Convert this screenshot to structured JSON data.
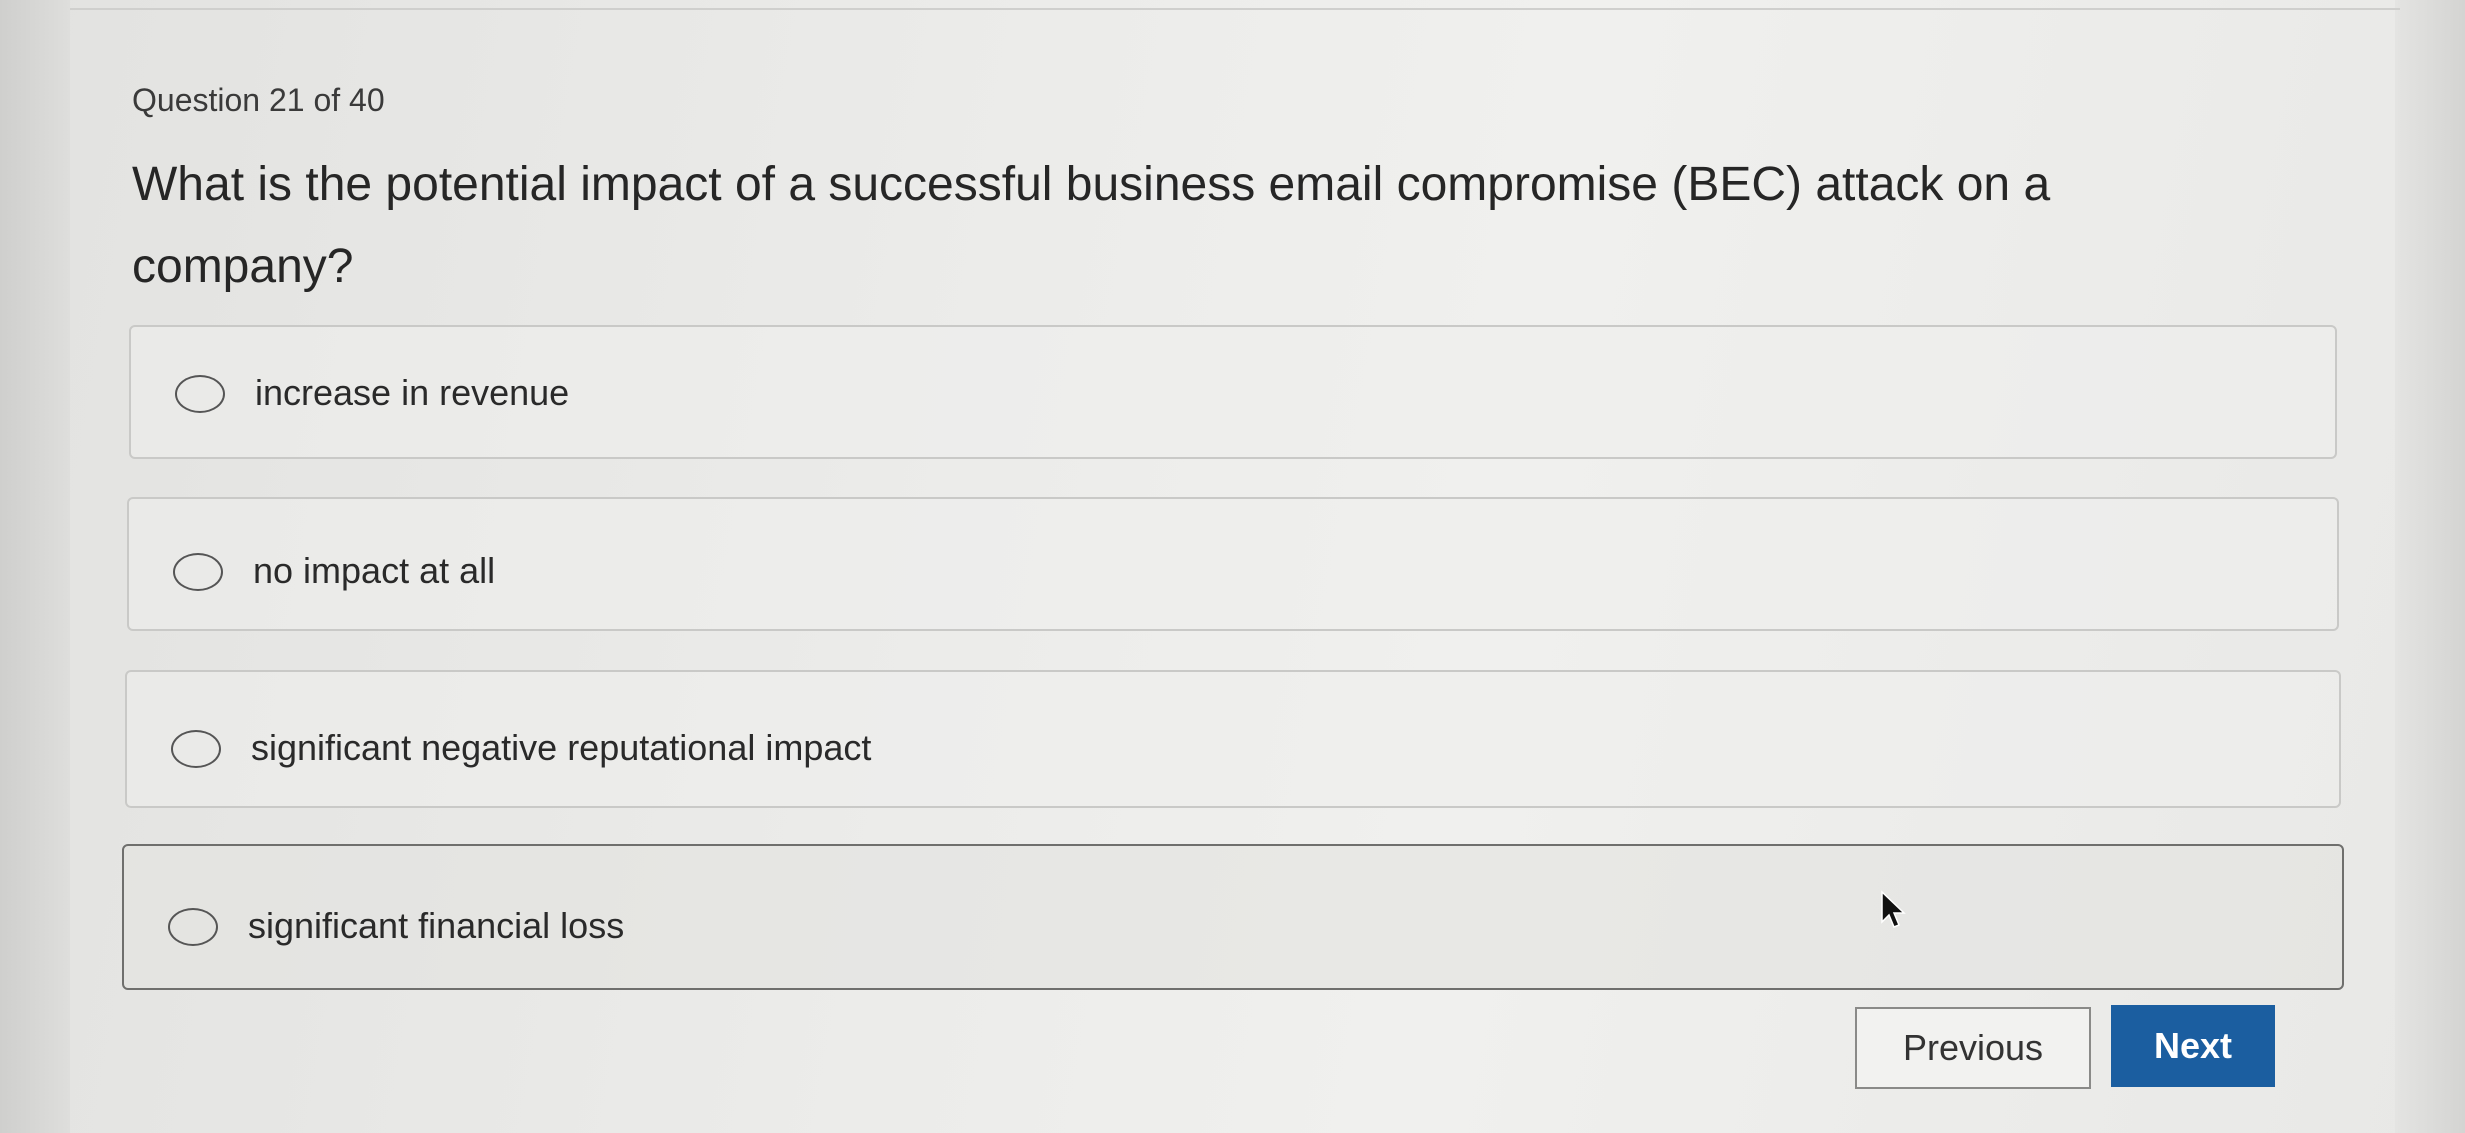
{
  "quiz": {
    "counter": "Question 21 of 40",
    "question": "What is the potential impact of a successful business email compromise (BEC) attack on a company?",
    "options": [
      {
        "label": "increase in revenue",
        "selected": false
      },
      {
        "label": "no impact at all",
        "selected": false
      },
      {
        "label": "significant negative reputational impact",
        "selected": false
      },
      {
        "label": "significant financial loss",
        "selected": false
      }
    ]
  },
  "navigation": {
    "previous_label": "Previous",
    "next_label": "Next"
  },
  "colors": {
    "next_button": "#1b5ea0",
    "text": "#262626"
  },
  "icons": {
    "radio": "radio-circle-icon",
    "cursor": "mouse-pointer-icon"
  }
}
